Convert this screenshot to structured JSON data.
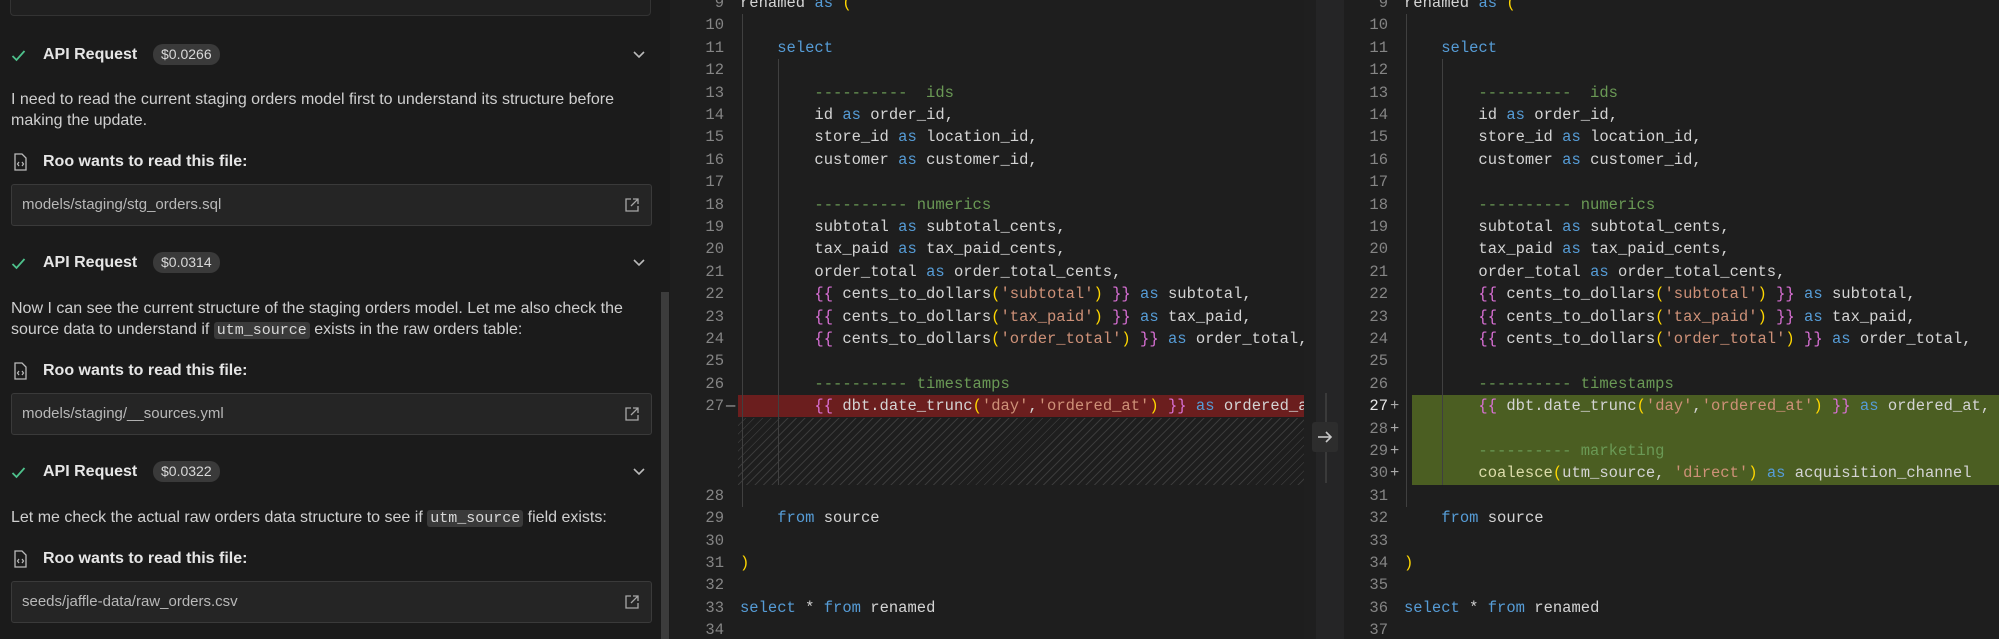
{
  "chat": {
    "requests": [
      {
        "title": "API Request",
        "cost": "$0.0266",
        "message_parts": [
          {
            "text": "I need to read the current staging orders model first to understand its structure before making the update.",
            "code": false
          }
        ],
        "read_label": "Roo wants to read this file:",
        "file_path": "models/staging/stg_orders.sql"
      },
      {
        "title": "API Request",
        "cost": "$0.0314",
        "message_parts": [
          {
            "text": "Now I can see the current structure of the staging orders model. Let me also check the source data to understand if ",
            "code": false
          },
          {
            "text": "utm_source",
            "code": true
          },
          {
            "text": " exists in the raw orders table:",
            "code": false
          }
        ],
        "read_label": "Roo wants to read this file:",
        "file_path": "models/staging/__sources.yml"
      },
      {
        "title": "API Request",
        "cost": "$0.0322",
        "message_parts": [
          {
            "text": "Let me check the actual raw orders data structure to see if ",
            "code": false
          },
          {
            "text": "utm_source",
            "code": true
          },
          {
            "text": " field exists:",
            "code": false
          }
        ],
        "read_label": "Roo wants to read this file:",
        "file_path": "seeds/jaffle-data/raw_orders.csv"
      }
    ],
    "icons": {
      "status": "check-icon",
      "expand": "chevron-down-icon",
      "file": "file-code-icon",
      "open": "open-external-icon"
    }
  },
  "diff": {
    "left": {
      "lines": [
        {
          "num": "9",
          "code": "renamed as (",
          "type": "normal"
        },
        {
          "num": "10",
          "code": "",
          "type": "normal"
        },
        {
          "num": "11",
          "code": "    select",
          "type": "normal"
        },
        {
          "num": "12",
          "code": "",
          "type": "normal"
        },
        {
          "num": "13",
          "code": "        ----------  ids",
          "type": "normal"
        },
        {
          "num": "14",
          "code": "        id as order_id,",
          "type": "normal"
        },
        {
          "num": "15",
          "code": "        store_id as location_id,",
          "type": "normal"
        },
        {
          "num": "16",
          "code": "        customer as customer_id,",
          "type": "normal"
        },
        {
          "num": "17",
          "code": "",
          "type": "normal"
        },
        {
          "num": "18",
          "code": "        ---------- numerics",
          "type": "normal"
        },
        {
          "num": "19",
          "code": "        subtotal as subtotal_cents,",
          "type": "normal"
        },
        {
          "num": "20",
          "code": "        tax_paid as tax_paid_cents,",
          "type": "normal"
        },
        {
          "num": "21",
          "code": "        order_total as order_total_cents,",
          "type": "normal"
        },
        {
          "num": "22",
          "code": "        {{ cents_to_dollars('subtotal') }} as subtotal,",
          "type": "normal"
        },
        {
          "num": "23",
          "code": "        {{ cents_to_dollars('tax_paid') }} as tax_paid,",
          "type": "normal"
        },
        {
          "num": "24",
          "code": "        {{ cents_to_dollars('order_total') }} as order_total,",
          "type": "normal"
        },
        {
          "num": "25",
          "code": "",
          "type": "normal"
        },
        {
          "num": "26",
          "code": "        ---------- timestamps",
          "type": "normal"
        },
        {
          "num": "27",
          "code": "        {{ dbt.date_trunc('day','ordered_at') }} as ordered_at",
          "type": "removed",
          "marker": "—"
        },
        {
          "num": "",
          "code": "",
          "type": "filler"
        },
        {
          "num": "",
          "code": "",
          "type": "filler"
        },
        {
          "num": "",
          "code": "",
          "type": "filler"
        },
        {
          "num": "28",
          "code": "",
          "type": "normal"
        },
        {
          "num": "29",
          "code": "    from source",
          "type": "normal"
        },
        {
          "num": "30",
          "code": "",
          "type": "normal"
        },
        {
          "num": "31",
          "code": ")",
          "type": "normal"
        },
        {
          "num": "32",
          "code": "",
          "type": "normal"
        },
        {
          "num": "33",
          "code": "select * from renamed",
          "type": "normal"
        },
        {
          "num": "34",
          "code": "",
          "type": "normal"
        }
      ]
    },
    "right": {
      "lines": [
        {
          "num": "9",
          "code": "renamed as (",
          "type": "normal"
        },
        {
          "num": "10",
          "code": "",
          "type": "normal"
        },
        {
          "num": "11",
          "code": "    select",
          "type": "normal"
        },
        {
          "num": "12",
          "code": "",
          "type": "normal"
        },
        {
          "num": "13",
          "code": "        ----------  ids",
          "type": "normal"
        },
        {
          "num": "14",
          "code": "        id as order_id,",
          "type": "normal"
        },
        {
          "num": "15",
          "code": "        store_id as location_id,",
          "type": "normal"
        },
        {
          "num": "16",
          "code": "        customer as customer_id,",
          "type": "normal"
        },
        {
          "num": "17",
          "code": "",
          "type": "normal"
        },
        {
          "num": "18",
          "code": "        ---------- numerics",
          "type": "normal"
        },
        {
          "num": "19",
          "code": "        subtotal as subtotal_cents,",
          "type": "normal"
        },
        {
          "num": "20",
          "code": "        tax_paid as tax_paid_cents,",
          "type": "normal"
        },
        {
          "num": "21",
          "code": "        order_total as order_total_cents,",
          "type": "normal"
        },
        {
          "num": "22",
          "code": "        {{ cents_to_dollars('subtotal') }} as subtotal,",
          "type": "normal"
        },
        {
          "num": "23",
          "code": "        {{ cents_to_dollars('tax_paid') }} as tax_paid,",
          "type": "normal"
        },
        {
          "num": "24",
          "code": "        {{ cents_to_dollars('order_total') }} as order_total,",
          "type": "normal"
        },
        {
          "num": "25",
          "code": "",
          "type": "normal"
        },
        {
          "num": "26",
          "code": "        ---------- timestamps",
          "type": "normal"
        },
        {
          "num": "27",
          "code": "        {{ dbt.date_trunc('day','ordered_at') }} as ordered_at,",
          "type": "added",
          "marker": "+"
        },
        {
          "num": "28",
          "code": "",
          "type": "added",
          "marker": "+"
        },
        {
          "num": "29",
          "code": "        ---------- marketing",
          "type": "added",
          "marker": "+"
        },
        {
          "num": "30",
          "code": "        coalesce(utm_source, 'direct') as acquisition_channel",
          "type": "added",
          "marker": "+"
        },
        {
          "num": "31",
          "code": "",
          "type": "normal"
        },
        {
          "num": "32",
          "code": "    from source",
          "type": "normal"
        },
        {
          "num": "33",
          "code": "",
          "type": "normal"
        },
        {
          "num": "34",
          "code": ")",
          "type": "normal"
        },
        {
          "num": "35",
          "code": "",
          "type": "normal"
        },
        {
          "num": "36",
          "code": "select * from renamed",
          "type": "normal"
        },
        {
          "num": "37",
          "code": "",
          "type": "normal"
        }
      ]
    },
    "arrow_icon": "arrow-right-icon"
  },
  "colors": {
    "removed": "#6b1e1e",
    "added": "#4b5e22",
    "keyword": "#569cd6",
    "comment": "#6a9955",
    "string": "#ce9178",
    "check": "#4ec28c"
  }
}
